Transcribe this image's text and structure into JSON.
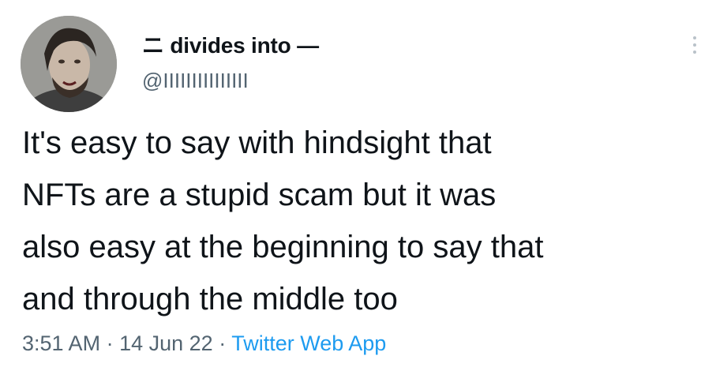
{
  "author": {
    "display_name": "ニ divides into —",
    "handle": "@IIIIIIIIIIIIIII"
  },
  "tweet": {
    "lines": [
      "It's easy to say with hindsight that",
      "NFTs are a stupid scam but it was",
      "also easy at the beginning to say that",
      "and through the middle too"
    ]
  },
  "meta": {
    "time": "3:51 AM",
    "separator": "·",
    "date": "14 Jun 22",
    "source": "Twitter Web App"
  },
  "icons": {
    "avatar": "avatar-photo",
    "more": "more-vertical-icon"
  },
  "colors": {
    "text": "#0f1419",
    "secondary": "#536471",
    "link": "#1d9bf0"
  }
}
